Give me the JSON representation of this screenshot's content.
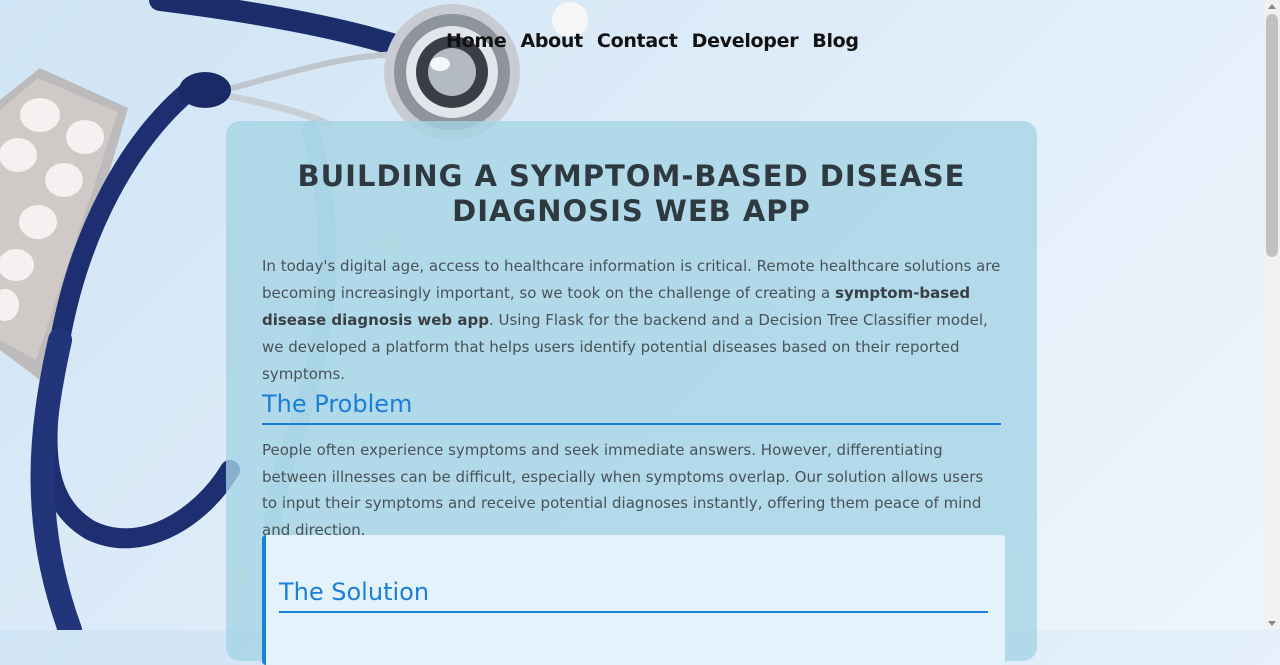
{
  "nav": {
    "items": [
      {
        "label": "Home"
      },
      {
        "label": "About"
      },
      {
        "label": "Contact"
      },
      {
        "label": "Developer"
      },
      {
        "label": "Blog"
      }
    ]
  },
  "article": {
    "title": "BUILDING A SYMPTOM-BASED DISEASE DIAGNOSIS WEB APP",
    "intro": {
      "before": "In today's digital age, access to healthcare information is critical. Remote healthcare solutions are becoming increasingly important, so we took on the challenge of creating a ",
      "bold": "symptom-based disease diagnosis web app",
      "after": ". Using Flask for the backend and a Decision Tree Classifier model, we developed a platform that helps users identify potential diseases based on their reported symptoms."
    },
    "problem": {
      "heading": "The Problem",
      "text": "People often experience symptoms and seek immediate answers. However, differentiating between illnesses can be difficult, especially when symptoms overlap. Our solution allows users to input their symptoms and receive potential diagnoses instantly, offering them peace of mind and direction."
    },
    "solution": {
      "heading": "The Solution"
    }
  },
  "colors": {
    "accent": "#1a7fd6",
    "card": "#a4d3e5",
    "title": "#2e3a40"
  },
  "icons": {
    "background": "stethoscope-and-pills-image"
  }
}
